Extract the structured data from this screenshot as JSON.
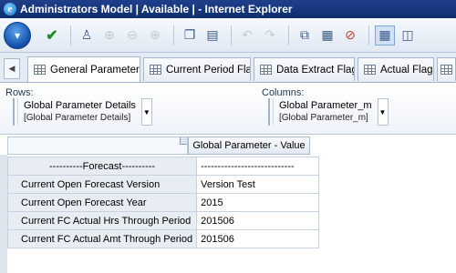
{
  "window": {
    "title": "Administrators Model | Available | - Internet Explorer"
  },
  "toolbar": {
    "icons": [
      "menu-circle-icon",
      "apply-check-icon",
      "users-icon",
      "add-circle-icon",
      "remove-circle-icon",
      "add-circle-alt-icon",
      "copy-icon",
      "paste-icon",
      "undo-icon",
      "redo-icon",
      "window-icon",
      "calendar-icon",
      "no-entry-icon",
      "grid-view-icon",
      "split-view-icon"
    ]
  },
  "tabs": [
    {
      "label": "General Parameters",
      "active": true
    },
    {
      "label": "Current Period Flag",
      "active": false
    },
    {
      "label": "Data Extract Flag",
      "active": false
    },
    {
      "label": "Actual Flag",
      "active": false
    }
  ],
  "dimensions": {
    "rows_label": "Rows:",
    "rows_name": "Global Parameter Details",
    "rows_sub": "[Global Parameter Details]",
    "columns_label": "Columns:",
    "columns_name": "Global Parameter_m",
    "columns_sub": "[Global Parameter_m]"
  },
  "grid": {
    "column_header": "Global Parameter - Value",
    "rows": [
      {
        "label": "----------Forecast----------",
        "value": "----------------------------"
      },
      {
        "label": "Current Open Forecast Version",
        "value": "Version Test"
      },
      {
        "label": "Current Open Forecast Year",
        "value": "2015"
      },
      {
        "label": "Current FC Actual Hrs Through Period",
        "value": "201506"
      },
      {
        "label": "Current FC Actual Amt Through Period",
        "value": "201506"
      }
    ]
  }
}
